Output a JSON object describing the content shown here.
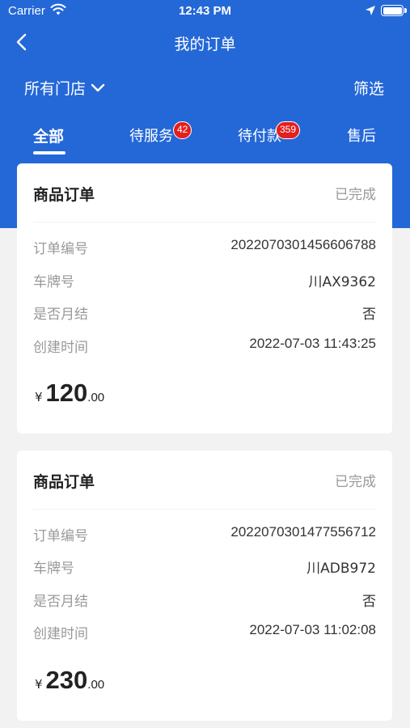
{
  "status_bar": {
    "carrier": "Carrier",
    "time": "12:43 PM"
  },
  "nav": {
    "title": "我的订单"
  },
  "filter_bar": {
    "store": "所有门店",
    "filter": "筛选"
  },
  "tabs": [
    {
      "label": "全部",
      "badge": ""
    },
    {
      "label": "待服务",
      "badge": "42"
    },
    {
      "label": "待付款",
      "badge": "359"
    },
    {
      "label": "售后",
      "badge": ""
    }
  ],
  "orders": [
    {
      "type": "商品订单",
      "status": "已完成",
      "fields": [
        {
          "label": "订单编号",
          "value": "2022070301456606788"
        },
        {
          "label": "车牌号",
          "value": "川AX9362"
        },
        {
          "label": "是否月结",
          "value": "否"
        },
        {
          "label": "创建时间",
          "value": "2022-07-03 11:43:25"
        }
      ],
      "price": {
        "currency": "¥",
        "integer": "120",
        "decimal": ".00"
      }
    },
    {
      "type": "商品订单",
      "status": "已完成",
      "fields": [
        {
          "label": "订单编号",
          "value": "2022070301477556712"
        },
        {
          "label": "车牌号",
          "value": "川ADB972"
        },
        {
          "label": "是否月结",
          "value": "否"
        },
        {
          "label": "创建时间",
          "value": "2022-07-03 11:02:08"
        }
      ],
      "price": {
        "currency": "¥",
        "integer": "230",
        "decimal": ".00"
      }
    }
  ],
  "colors": {
    "primary": "#2468d8",
    "badge": "#e41f1f",
    "background": "#f2f2f2"
  },
  "icons": {
    "back": "chevron-left-icon",
    "store_dropdown": "chevron-down-icon",
    "wifi": "wifi-icon",
    "location": "location-arrow-icon",
    "battery": "battery-icon"
  }
}
